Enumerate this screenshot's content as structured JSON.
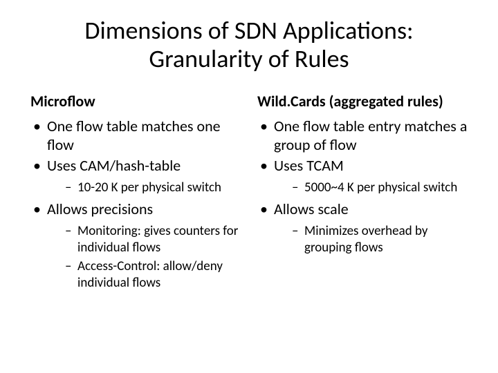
{
  "title_line1": "Dimensions of SDN Applications:",
  "title_line2": "Granularity of Rules",
  "left": {
    "heading": "Microflow",
    "b1": "One flow table matches one flow",
    "b2": "Uses CAM/hash-table",
    "b2s1": "10-20 K per physical switch",
    "b3": "Allows precisions",
    "b3s1": "Monitoring: gives counters for individual flows",
    "b3s2": "Access-Control: allow/deny individual flows"
  },
  "right": {
    "heading": "Wild.Cards (aggregated rules)",
    "b1": "One flow table entry matches a group of flow",
    "b2": "Uses TCAM",
    "b2s1": "5000~4 K per physical switch",
    "b3": "Allows scale",
    "b3s1": "Minimizes overhead by grouping flows"
  }
}
